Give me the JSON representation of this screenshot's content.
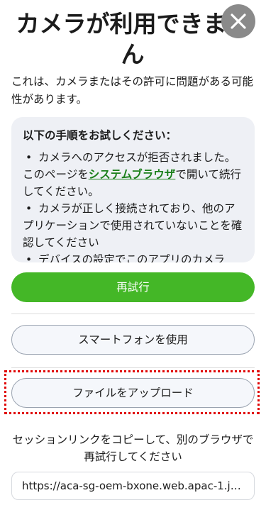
{
  "header": {
    "title": "カメラが利用できません",
    "close_icon": "close-icon"
  },
  "intro": "これは、カメラまたはその許可に問題がある可能性があります。",
  "tips": {
    "heading": "以下の手順をお試しください：",
    "items": [
      {
        "bullet": "•",
        "before": "カメラへのアクセスが拒否されました。このページを",
        "link": "システムブラウザ",
        "after": "で開いて続行してください。"
      },
      {
        "bullet": "•",
        "text": "カメラが正しく接続されており、他のアプリケーションで使用されていないことを確認してください"
      },
      {
        "bullet": "•",
        "text": "デバイスの設定でこのアプリのカメラ"
      }
    ]
  },
  "buttons": {
    "retry": "再試行",
    "use_smartphone": "スマートフォンを使用",
    "upload_file": "ファイルをアップロード"
  },
  "session": {
    "instruction": "セッションリンクをコピーして、別のブラウザで再試行してください",
    "link": "https://aca-sg-oem-bxone.web.apac-1.ju..."
  },
  "colors": {
    "primary": "#44b727",
    "link": "#1a7f1a",
    "highlight": "#e00000",
    "panel": "#eef0f5"
  }
}
